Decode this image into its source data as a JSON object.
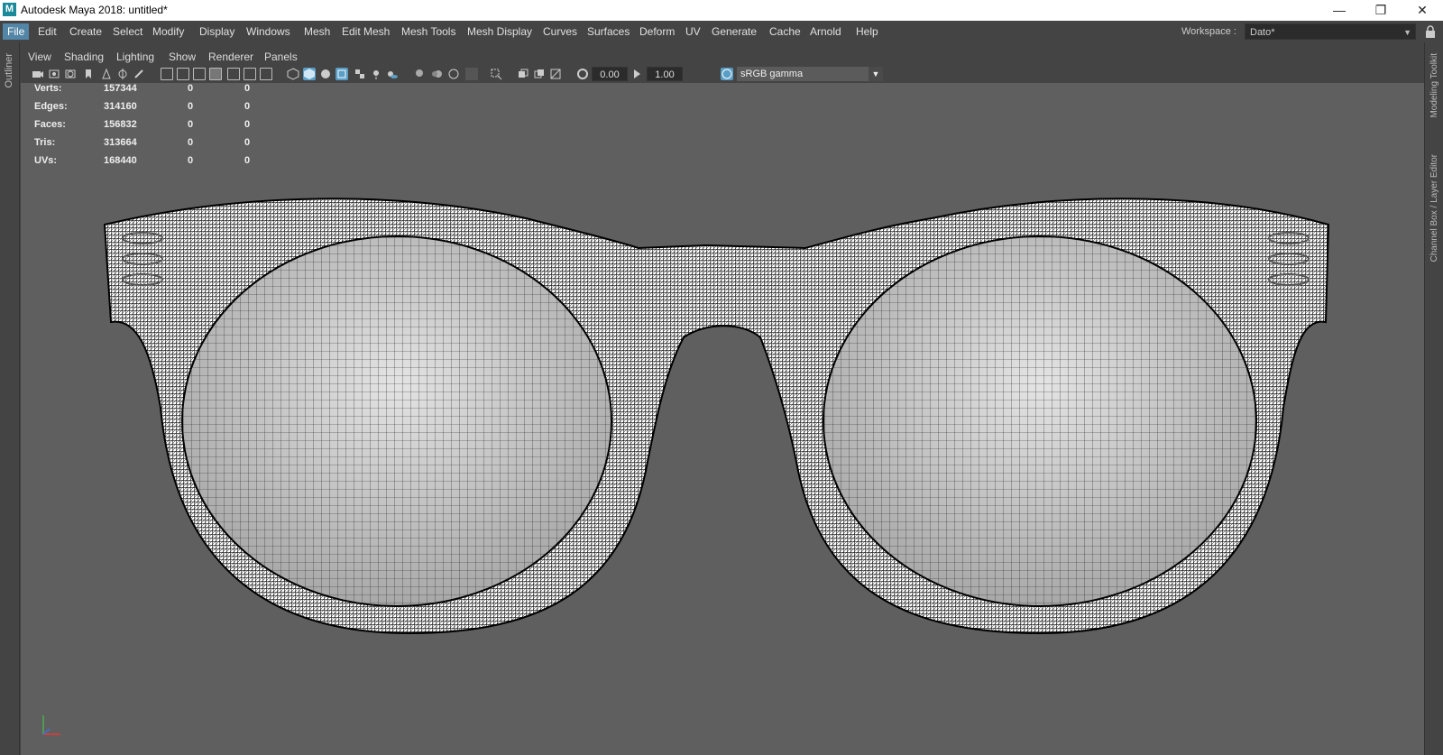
{
  "window": {
    "app_icon_letter": "M",
    "title": "Autodesk Maya 2018: untitled*",
    "minimize_glyph": "—",
    "restore_glyph": "❐",
    "close_glyph": "✕"
  },
  "menubar": {
    "items": [
      "File",
      "Edit",
      "Create",
      "Select",
      "Modify",
      "Display",
      "Windows",
      "Mesh",
      "Edit Mesh",
      "Mesh Tools",
      "Mesh Display",
      "Curves",
      "Surfaces",
      "Deform",
      "UV",
      "Generate",
      "Cache",
      "Arnold",
      "Help"
    ],
    "active": "File",
    "workspace_label": "Workspace :",
    "workspace_value": "Dato*"
  },
  "side_tabs": {
    "left": "Outliner",
    "right_top": "Modeling Toolkit",
    "right_bottom": "Channel Box / Layer Editor"
  },
  "panel_menus": [
    "View",
    "Shading",
    "Lighting",
    "Show",
    "Renderer",
    "Panels"
  ],
  "toolbar": {
    "exposure": "0.00",
    "gamma": "1.00",
    "color_space": "sRGB gamma"
  },
  "hud": {
    "rows": [
      {
        "label": "Verts:",
        "v1": "157344",
        "v2": "0",
        "v3": "0"
      },
      {
        "label": "Edges:",
        "v1": "314160",
        "v2": "0",
        "v3": "0"
      },
      {
        "label": "Faces:",
        "v1": "156832",
        "v2": "0",
        "v3": "0"
      },
      {
        "label": "Tris:",
        "v1": "313664",
        "v2": "0",
        "v3": "0"
      },
      {
        "label": "UVs:",
        "v1": "168440",
        "v2": "0",
        "v3": "0"
      }
    ]
  },
  "colors": {
    "accent": "#5285a6",
    "viewport_bg": "#5f5f5f",
    "ui_bg": "#444444"
  }
}
